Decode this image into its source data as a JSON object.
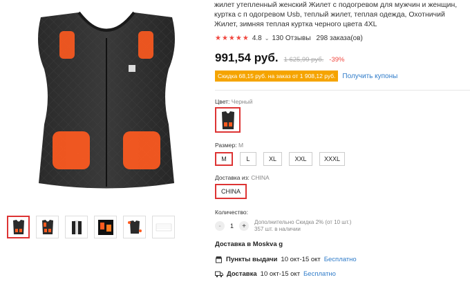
{
  "product": {
    "title": "жилет утепленный женский Жилет с подогревом для мужчин и женщин, куртка с п одогревом Usb, теплый жилет, теплая одежда, Охотничий Жилет, зимняя теплая куртка черного цвета 4XL",
    "rating": "4.8",
    "reviews": "130 Отзывы",
    "orders": "298 заказа(ов)",
    "price": "991,54 руб.",
    "old_price": "1 625,99 руб.",
    "discount": "-39%",
    "coupon_text": "Скидка 68,15 руб. на заказ от 1 908,12 руб.",
    "coupon_link": "Получить купоны"
  },
  "options": {
    "color_label": "Цвет:",
    "color_value": "Черный",
    "size_label": "Размер:",
    "size_value": "M",
    "sizes": [
      "M",
      "L",
      "XL",
      "XXL",
      "XXXL"
    ],
    "ship_label": "Доставка из:",
    "ship_value": "CHINA",
    "ship_option": "CHINA"
  },
  "quantity": {
    "label": "Количество:",
    "minus": "-",
    "value": "1",
    "plus": "+",
    "note1": "Дополнительно Скидка 2% (от 10 шт.)",
    "note2": "357 шт. в наличии"
  },
  "delivery": {
    "title": "Доставка в Moskva g",
    "pickup_label": "Пункты выдачи",
    "pickup_dates": "10 окт-15 окт",
    "pickup_price": "Бесплатно",
    "delivery_label": "Доставка",
    "delivery_dates": "10 окт-15 окт",
    "delivery_price": "Бесплатно"
  },
  "icons": {
    "heater": "heat-pad-icon",
    "store": "store-icon",
    "truck": "truck-icon"
  },
  "colors": {
    "accent": "#f0463e",
    "coupon": "#f5a400",
    "link": "#2e7bc9",
    "heat": "#ff5a1f"
  }
}
